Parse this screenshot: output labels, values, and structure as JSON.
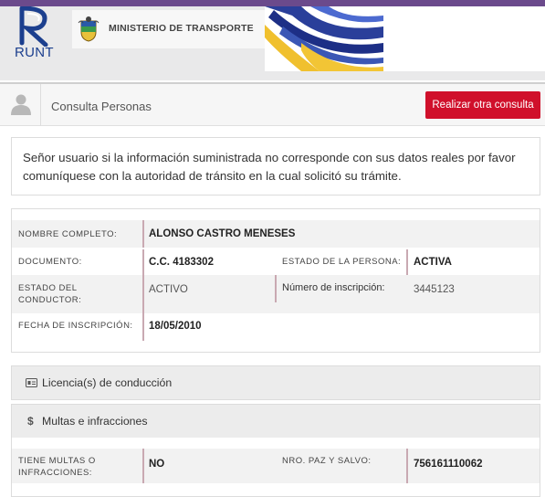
{
  "brand": {
    "runt_label": "RUNT",
    "ministerio_label": "MINISTERIO DE TRANSPORTE"
  },
  "colors": {
    "accent_red": "#d0102b",
    "top_bar": "#6b4a8c",
    "runt_blue": "#1c3f8e"
  },
  "consulta": {
    "title": "Consulta Personas",
    "button_label": "Realizar otra consulta"
  },
  "notice": "Señor usuario si la información suministrada no corresponde con sus datos reales por favor comuníquese con la autoridad de tránsito en la cual solicitó su trámite.",
  "persona": {
    "nombre_label": "NOMBRE COMPLETO:",
    "nombre_value": "ALONSO CASTRO MENESES",
    "documento_label": "DOCUMENTO:",
    "documento_value": "C.C. 4183302",
    "estado_persona_label": "ESTADO DE LA PERSONA:",
    "estado_persona_value": "ACTIVA",
    "estado_conductor_label": "ESTADO DEL CONDUCTOR:",
    "estado_conductor_value": "ACTIVO",
    "inscripcion_num_label": "Número de inscripción:",
    "inscripcion_num_value": "3445123",
    "fecha_label": "FECHA DE INSCRIPCIÓN:",
    "fecha_value": "18/05/2010"
  },
  "sections": {
    "licencias": {
      "title": "Licencia(s) de conducción",
      "icon": "license-card-icon"
    },
    "multas": {
      "title": "Multas e infracciones",
      "icon": "dollar-icon",
      "icon_glyph": "$"
    }
  },
  "multas": {
    "tiene_label": "TIENE MULTAS O INFRACCIONES:",
    "tiene_value": "NO",
    "paz_label": "NRO. PAZ Y SALVO:",
    "paz_value": "756161110062"
  }
}
